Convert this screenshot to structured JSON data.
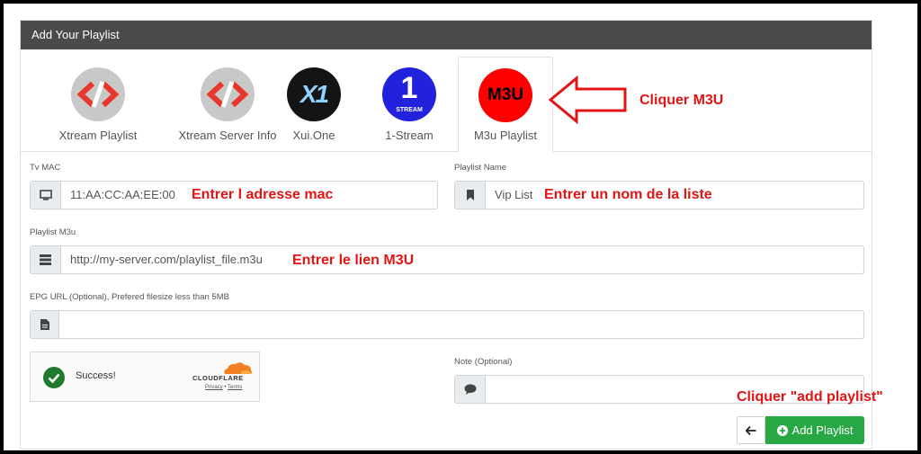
{
  "card": {
    "title": "Add Your Playlist"
  },
  "tabs": [
    {
      "label": "Xtream Playlist",
      "icon": "xtream-logo-icon"
    },
    {
      "label": "Xtream Server Info",
      "icon": "xtream-logo-icon"
    },
    {
      "label": "Xui.One",
      "icon": "xui-one-logo-icon",
      "logo_text": "X1"
    },
    {
      "label": "1-Stream",
      "icon": "1-stream-logo-icon",
      "logo_text": "1",
      "logo_sub": "STREAM"
    },
    {
      "label": "M3u Playlist",
      "icon": "m3u-logo-icon",
      "logo_text": "M3U",
      "active": true
    }
  ],
  "form": {
    "mac": {
      "label": "Tv MAC",
      "value": "11:AA:CC:AA:EE:00",
      "icon": "monitor-icon"
    },
    "name": {
      "label": "Playlist Name",
      "value": "Vip List",
      "icon": "bookmark-icon"
    },
    "m3u": {
      "label": "Playlist M3u",
      "value": "http://my-server.com/playlist_file.m3u",
      "icon": "server-icon"
    },
    "epg": {
      "label": "EPG URL (Optional), Prefered filesize less than 5MB",
      "value": "",
      "icon": "file-icon"
    },
    "note": {
      "label": "Note (Optional)",
      "value": "",
      "icon": "comment-icon"
    }
  },
  "captcha": {
    "status": "Success!",
    "brand": "CLOUDFLARE",
    "privacy": "Privacy",
    "separator": "•",
    "terms": "Terms"
  },
  "buttons": {
    "add": "Add Playlist"
  },
  "annotations": {
    "click_m3u": "Cliquer M3U",
    "enter_mac": "Entrer l adresse mac",
    "enter_name": "Entrer un nom de la liste",
    "enter_link": "Entrer le lien M3U",
    "click_add": "Cliquer \"add playlist\""
  },
  "colors": {
    "header": "#4a4a4a",
    "annotation": "#e31414",
    "add_button": "#28a745",
    "m3u_logo": "#ff0000"
  }
}
